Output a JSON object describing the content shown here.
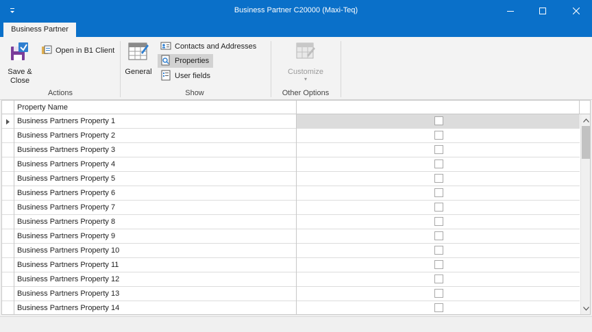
{
  "window": {
    "title": "Business Partner C20000 (Maxi-Teq)"
  },
  "ribbon": {
    "tab_label": "Business Partner",
    "actions": {
      "group_label": "Actions",
      "save_close_line1": "Save &",
      "save_close_line2": "Close",
      "open_b1_label": "Open in B1 Client"
    },
    "show": {
      "group_label": "Show",
      "general_label": "General",
      "contacts_label": "Contacts and Addresses",
      "properties_label": "Properties",
      "user_fields_label": "User fields"
    },
    "other": {
      "group_label": "Other Options",
      "customize_label": "Customize"
    }
  },
  "grid": {
    "columns": [
      "Property Name",
      ""
    ],
    "selected_row_index": 0,
    "rows": [
      {
        "name": "Business Partners Property 1",
        "checked": false
      },
      {
        "name": "Business Partners Property 2",
        "checked": false
      },
      {
        "name": "Business Partners Property 3",
        "checked": false
      },
      {
        "name": "Business Partners Property 4",
        "checked": false
      },
      {
        "name": "Business Partners Property 5",
        "checked": false
      },
      {
        "name": "Business Partners Property 6",
        "checked": false
      },
      {
        "name": "Business Partners Property 7",
        "checked": false
      },
      {
        "name": "Business Partners Property 8",
        "checked": false
      },
      {
        "name": "Business Partners Property 9",
        "checked": false
      },
      {
        "name": "Business Partners Property 10",
        "checked": false
      },
      {
        "name": "Business Partners Property 11",
        "checked": false
      },
      {
        "name": "Business Partners Property 12",
        "checked": false
      },
      {
        "name": "Business Partners Property 13",
        "checked": false
      },
      {
        "name": "Business Partners Property 14",
        "checked": false
      }
    ]
  },
  "colors": {
    "title_bar": "#0a70c9",
    "ribbon_bg": "#f3f3f3",
    "selected_cell": "#dcdcdc"
  }
}
